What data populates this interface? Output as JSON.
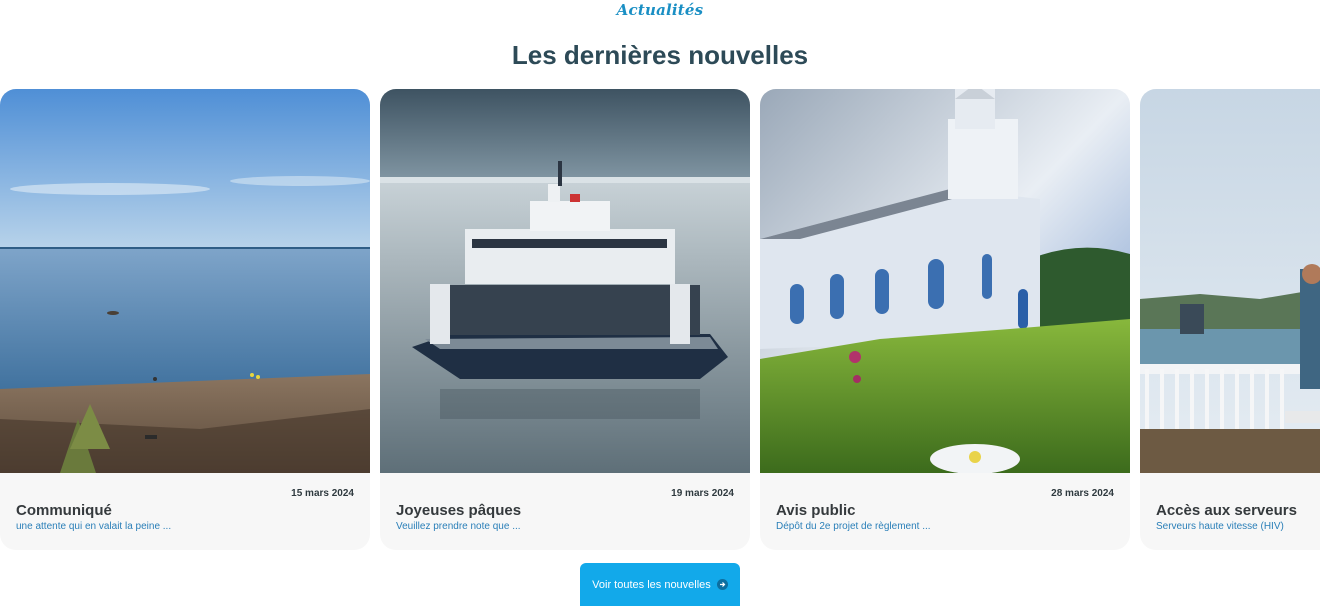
{
  "section": {
    "eyebrow": "Actualités",
    "title": "Les dernières nouvelles"
  },
  "cards": [
    {
      "date": "15 mars 2024",
      "title": "Communiqué",
      "excerpt": "une attente qui en valait la peine ...",
      "image": "beach-shoreline-photo"
    },
    {
      "date": "19 mars 2024",
      "title": "Joyeuses pâques",
      "excerpt": "Veuillez prendre note que ...",
      "image": "ferry-boat-photo"
    },
    {
      "date": "28 mars 2024",
      "title": "Avis public",
      "excerpt": "Dépôt du 2e projet de règlement ...",
      "image": "white-church-photo"
    },
    {
      "date": "",
      "title": "Accès aux serveurs",
      "excerpt": "Serveurs haute vitesse (HIV)",
      "image": "deck-view-photo"
    }
  ],
  "cta": {
    "label": "Voir toutes les nouvelles",
    "icon": "arrow-right-circle-icon"
  },
  "colors": {
    "accent": "#12a9ea",
    "title": "#2d4a57",
    "excerpt": "#2a7fb8"
  }
}
